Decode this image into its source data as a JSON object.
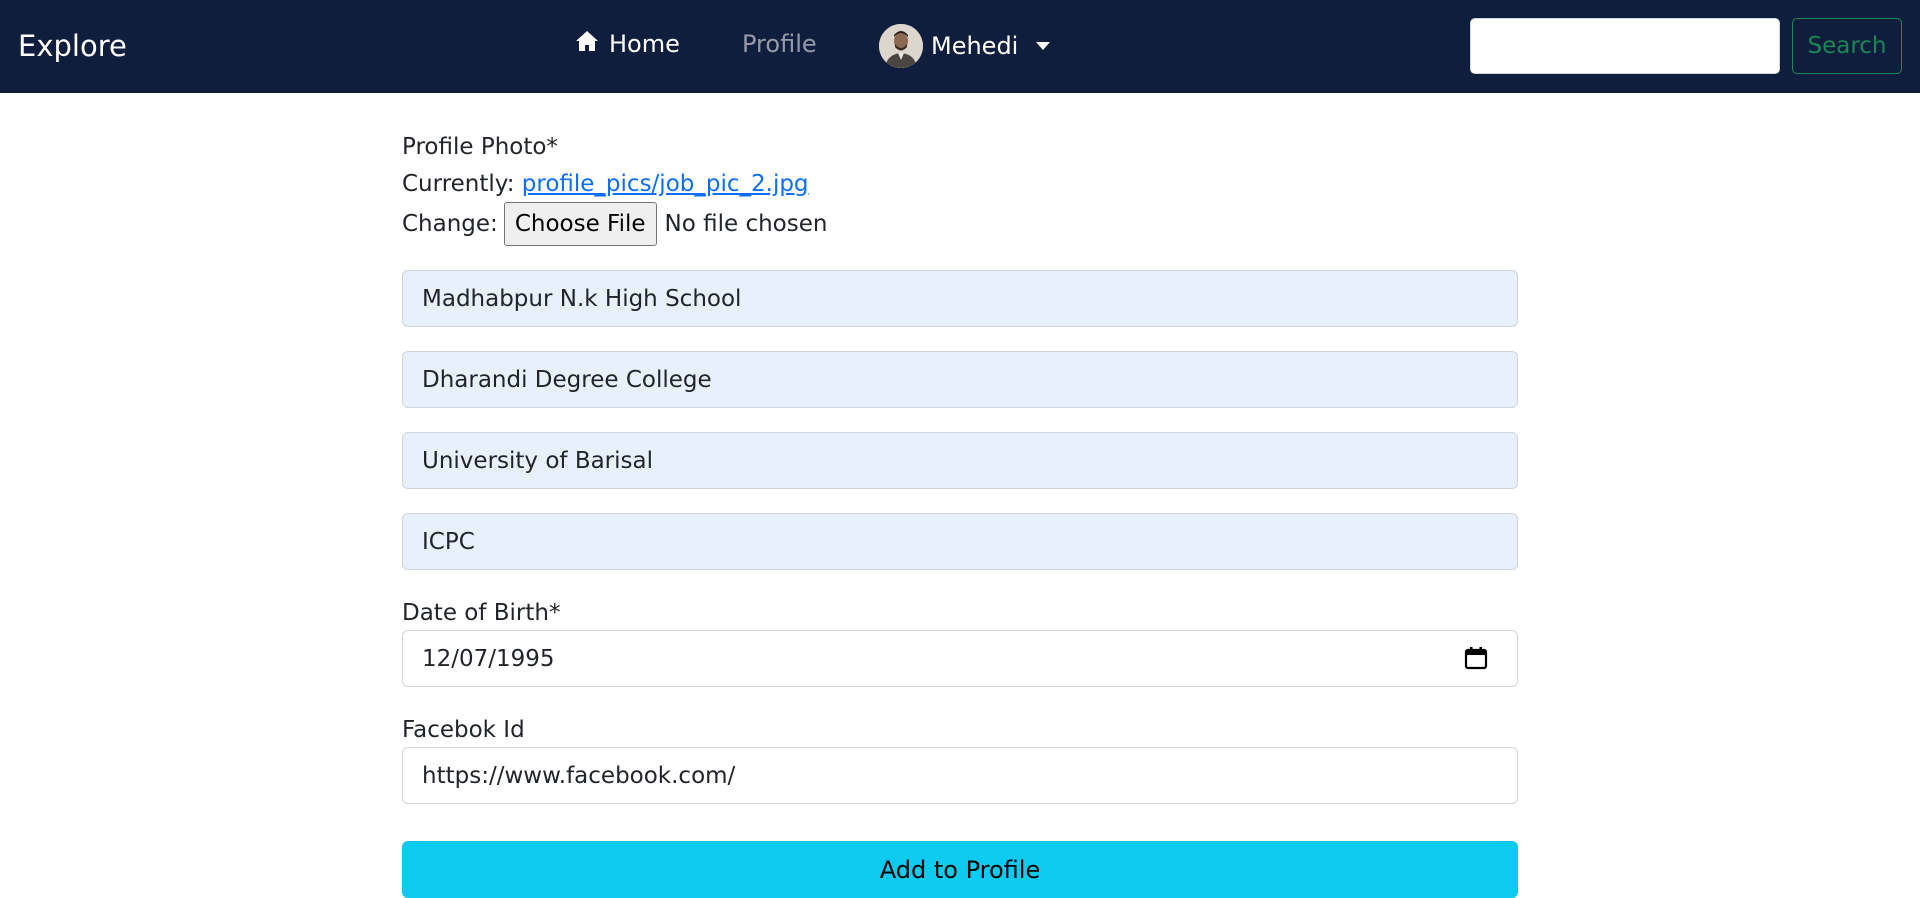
{
  "navbar": {
    "brand": "Explore",
    "home_label": "Home",
    "profile_label": "Profile",
    "user_name": "Mehedi",
    "search_placeholder": "",
    "search_button": "Search"
  },
  "form": {
    "photo_label": "Profile Photo*",
    "photo_currently_label": "Currently:",
    "photo_current_file": "profile_pics/job_pic_2.jpg",
    "photo_change_label": "Change:",
    "file_button": "Choose File",
    "file_status": "No file chosen",
    "school": "Madhabpur N.k High School",
    "college": "Dharandi Degree College",
    "university": "University of Barisal",
    "extra": "ICPC",
    "dob_label": "Date of Birth*",
    "dob_value": "12/07/1995",
    "facebook_label": "Facebok Id",
    "facebook_value": "https://www.facebook.com/",
    "submit_label": "Add to Profile"
  },
  "colors": {
    "navbar_bg": "#101e3d",
    "autofill_bg": "#e8f0fe",
    "submit_bg": "#0dcaf0",
    "search_outline": "#198754",
    "link": "#0d6efd"
  },
  "icons": {
    "home": "home-icon",
    "calendar": "calendar-icon",
    "dropdown": "caret-down-icon"
  }
}
